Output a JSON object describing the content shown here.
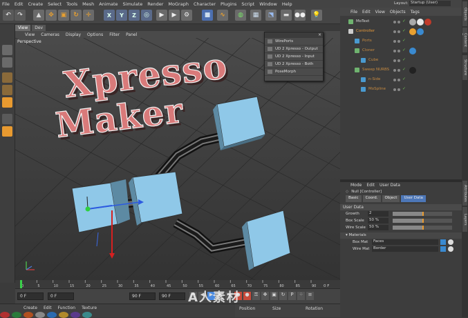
{
  "main_menu": [
    "File",
    "Edit",
    "Create",
    "Select",
    "Tools",
    "Mesh",
    "Animate",
    "Simulate",
    "Render",
    "MoGraph",
    "Character",
    "Plugins",
    "Script",
    "Window",
    "Help"
  ],
  "layout": {
    "label": "Layout:",
    "value": "Startup (User)"
  },
  "viewport": {
    "tabs": [
      "View",
      "Dev"
    ],
    "menu": [
      "View",
      "Cameras",
      "Display",
      "Options",
      "Filter",
      "Panel"
    ],
    "camera": "Perspective",
    "title_line1": "Xpresso",
    "title_line2": "Maker"
  },
  "popup_items": [
    "WirePorts",
    "UD 2 Xpresso - Output",
    "UD 2 Xpresso - Input",
    "UD 2 Xpresso - Both",
    "PoseMorph"
  ],
  "toolbar_letters": [
    "X",
    "Y",
    "Z"
  ],
  "timeline": {
    "ticks": [
      "0",
      "5",
      "10",
      "15",
      "20",
      "25",
      "30",
      "35",
      "40",
      "45",
      "50",
      "55",
      "60",
      "65",
      "70",
      "75",
      "80",
      "85",
      "90"
    ],
    "end_label": "0 F"
  },
  "transport": {
    "frame_a": "0 F",
    "frame_b": "0 F",
    "frame_c": "90 F",
    "frame_d": "90 F"
  },
  "material_menu": [
    "Create",
    "Edit",
    "Function",
    "Texture"
  ],
  "coord_headers": [
    "Position",
    "Size",
    "Rotation"
  ],
  "object_manager": {
    "menu": [
      "File",
      "Edit",
      "View",
      "Objects",
      "Tags"
    ],
    "objects": [
      {
        "name": "MoText",
        "indent": 0,
        "color": "#d8d8d8"
      },
      {
        "name": "Controller",
        "indent": 0,
        "color": "#e79a3a"
      },
      {
        "name": "Ports",
        "indent": 1,
        "color": "#c78a40"
      },
      {
        "name": "Cloner",
        "indent": 1,
        "color": "#c78a40"
      },
      {
        "name": "Cube",
        "indent": 2,
        "color": "#c78a40"
      },
      {
        "name": "Sweep NURBS",
        "indent": 1,
        "color": "#c78a40"
      },
      {
        "name": "n-Side",
        "indent": 2,
        "color": "#c78a40"
      },
      {
        "name": "MoSpline",
        "indent": 2,
        "color": "#c78a40"
      }
    ]
  },
  "attributes": {
    "menu": [
      "Mode",
      "Edit",
      "User Data"
    ],
    "object_label": "Null [Controller]",
    "tabs": [
      "Basic",
      "Coord.",
      "Object",
      "User Data"
    ],
    "active_tab": "User Data",
    "section": "User Data",
    "fields": [
      {
        "label": "Growth",
        "value": "2",
        "fill": 0.5
      },
      {
        "label": "Box Scale",
        "value": "50 %",
        "fill": 0.5
      },
      {
        "label": "Wire Scale",
        "value": "50 %",
        "fill": 0.5
      }
    ],
    "materials_group": "Materials",
    "links": [
      {
        "label": "Box Mat",
        "value": "Faces"
      },
      {
        "label": "Wire Mat",
        "value": "Border"
      }
    ]
  },
  "side_tabs": [
    "Objects",
    "Content Browser",
    "Structure",
    "Attributes",
    "Layers"
  ],
  "watermark": "A人素材"
}
